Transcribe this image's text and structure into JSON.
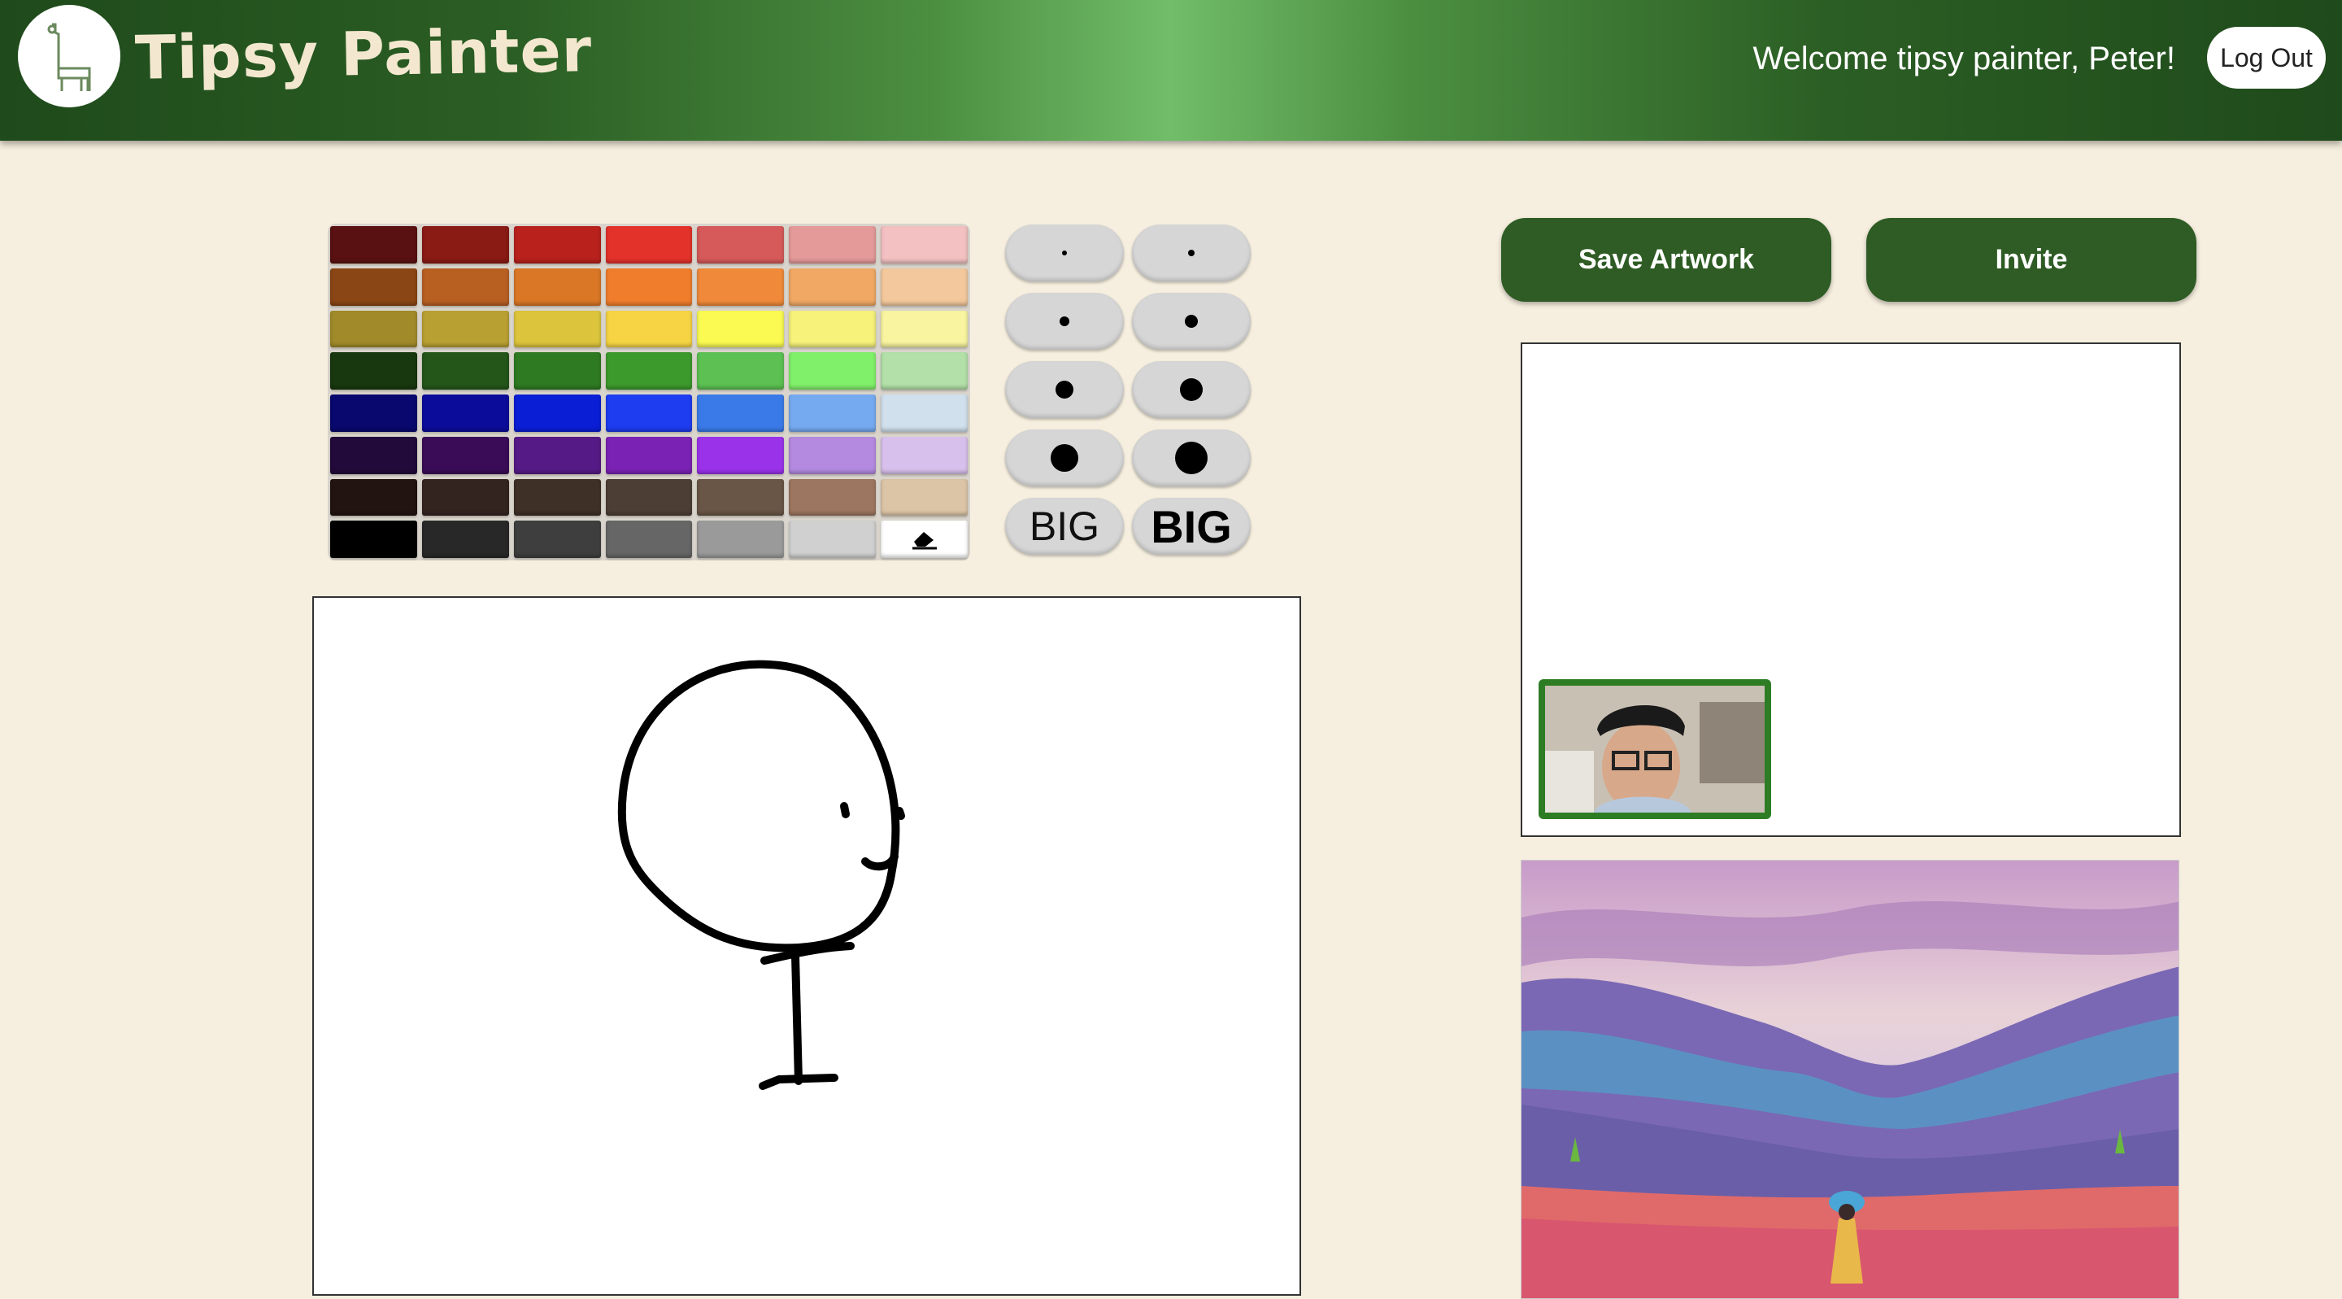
{
  "header": {
    "app_title": "Tipsy Painter",
    "welcome": "Welcome tipsy painter, Peter!",
    "logout_label": "Log Out"
  },
  "palette": {
    "rows": [
      [
        "#5a1111",
        "#8a1a14",
        "#b8211c",
        "#e3322a",
        "#d65a5a",
        "#e59a9a",
        "#f3c1c1"
      ],
      [
        "#8a4614",
        "#b85f22",
        "#d97726",
        "#f07d2c",
        "#f08a3a",
        "#f0a864",
        "#f3c89c"
      ],
      [
        "#a08a2a",
        "#b8a032",
        "#dcc43c",
        "#f6d444",
        "#fafa52",
        "#f6f27a",
        "#f8f4a0"
      ],
      [
        "#18380f",
        "#24561a",
        "#2e7a22",
        "#3c9a2c",
        "#5cc052",
        "#80f06a",
        "#b2e0a8"
      ],
      [
        "#08086e",
        "#0c0c9a",
        "#0a1ed6",
        "#1e3cf0",
        "#3a7ae8",
        "#76aaf0",
        "#d0e0ec"
      ],
      [
        "#220a3a",
        "#3a0c58",
        "#561a86",
        "#7a22b4",
        "#9a32ea",
        "#b48ae0",
        "#d8c0ec"
      ],
      [
        "#221410",
        "#342420",
        "#3e3026",
        "#4c3e34",
        "#6a5646",
        "#9c7660",
        "#dcc4a6"
      ],
      [
        "#000000",
        "#282828",
        "#3e3e3e",
        "#666666",
        "#9a9a9a",
        "#d0d0d0",
        "#ffffff"
      ]
    ],
    "eraser_icon": "eraser-icon"
  },
  "brushes": {
    "sizes": [
      6,
      8,
      12,
      16,
      22,
      28,
      34,
      40
    ],
    "big_label": "BIG",
    "big_bold_label": "BIG"
  },
  "actions": {
    "save_label": "Save Artwork",
    "invite_label": "Invite"
  }
}
